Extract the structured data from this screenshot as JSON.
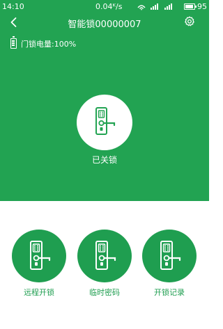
{
  "status_bar": {
    "time": "14:10",
    "network_speed": "0.04ᴷ/s",
    "signal_icons": "wifi-icon, signal-icon",
    "battery_level": "95",
    "battery_fill": 0.95
  },
  "header": {
    "back_icon": "chevron-left-icon",
    "title": "智能锁00000007",
    "settings_icon": "gear-icon"
  },
  "lock_info": {
    "battery_icon": "battery-icon",
    "battery_text": "门锁电量:100%",
    "lock_icon": "door-lock-icon",
    "lock_status": "已关锁"
  },
  "actions": [
    {
      "icon": "door-lock-icon",
      "label": "远程开锁"
    },
    {
      "icon": "door-lock-icon",
      "label": "临时密码"
    },
    {
      "icon": "door-lock-icon",
      "label": "开锁记录"
    }
  ],
  "colors": {
    "primary_green": "#22a352",
    "action_green": "#1f9e50",
    "background": "#ffffff"
  }
}
